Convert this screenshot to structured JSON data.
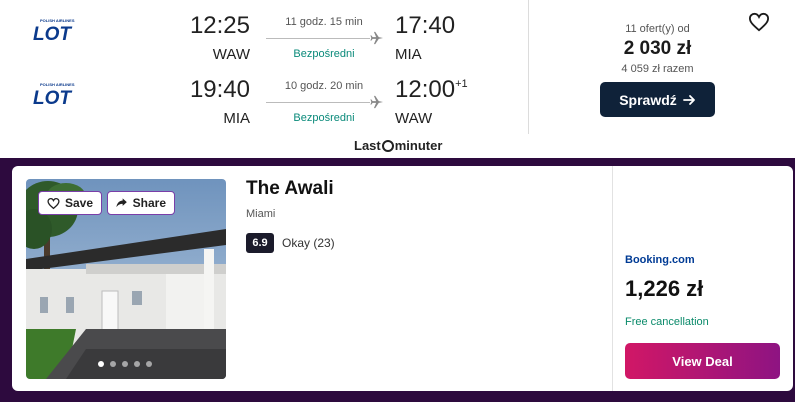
{
  "flight": {
    "airline_logo_text": "LOT",
    "airline_logo_subtext": "POLISH AIRLINES",
    "outbound": {
      "dep_time": "12:25",
      "dep_code": "WAW",
      "duration": "11 godz. 15 min",
      "stops": "Bezpośredni",
      "arr_time": "17:40",
      "arr_code": "MIA",
      "day_offset": ""
    },
    "return": {
      "dep_time": "19:40",
      "dep_code": "MIA",
      "duration": "10 godz. 20 min",
      "stops": "Bezpośredni",
      "arr_time": "12:00",
      "arr_code": "WAW",
      "day_offset": "+1"
    },
    "offers_count": "11 ofert(y) od",
    "price": "2 030 zł",
    "price_total": "4 059 zł razem",
    "check_button": "Sprawdź",
    "provider_part1": "Last",
    "provider_part2": "minuter"
  },
  "hotel": {
    "save_label": "Save",
    "share_label": "Share",
    "name": "The Awali",
    "city": "Miami",
    "rating": "6.9",
    "rating_text": "Okay (23)",
    "booking_site": "Booking.com",
    "price": "1,226 zł",
    "free_cancellation": "Free cancellation",
    "view_deal_label": "View Deal",
    "photo_count": 5,
    "active_photo": 0
  },
  "colors": {
    "brand_navy": "#0f2239",
    "hotel_band_bg": "#2d0a3e",
    "deal_gradient_start": "#d11766",
    "deal_gradient_end": "#8e1482",
    "stops_green": "#0a8a7a",
    "lot_blue": "#0b3a8c"
  },
  "icons": [
    "heart-icon",
    "plane-icon",
    "arrow-right-icon",
    "share-arrow-icon",
    "lot-logo",
    "lastminuter-logo"
  ]
}
